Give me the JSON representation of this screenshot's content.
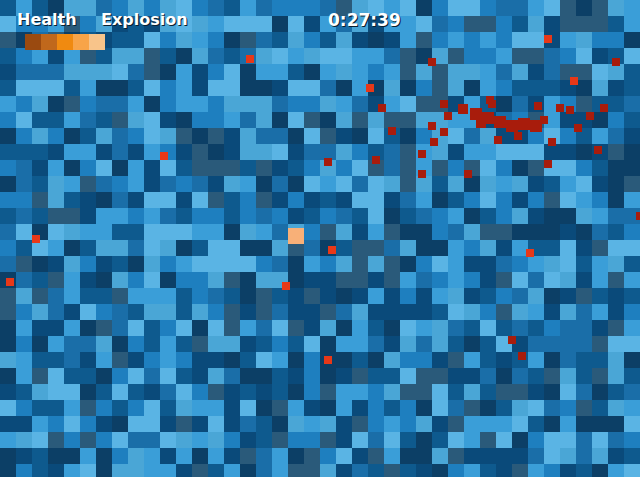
{
  "hud": {
    "health": {
      "label": "Health",
      "level": 1.0
    },
    "explosion": {
      "label": "Explosion",
      "level": 0.0
    },
    "timer": "0:27:39"
  }
}
